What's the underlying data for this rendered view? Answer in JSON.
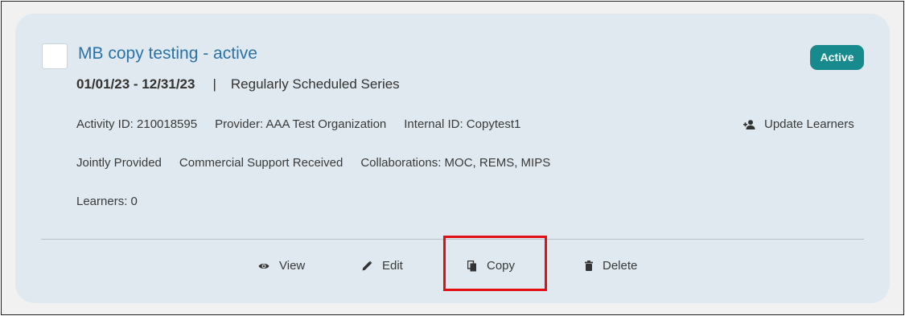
{
  "activity": {
    "title": "MB copy testing - active",
    "status": "Active",
    "dates": "01/01/23 - 12/31/23",
    "separator": "|",
    "series_type": "Regularly Scheduled Series",
    "activity_id": "Activity ID: 210018595",
    "provider": "Provider: AAA Test Organization",
    "internal_id": "Internal ID: Copytest1",
    "jointly_provided": "Jointly Provided",
    "commercial_support": "Commercial Support Received",
    "collaborations": "Collaborations: MOC, REMS, MIPS",
    "learners": "Learners: 0"
  },
  "actions": {
    "update_learners": "Update Learners",
    "view": "View",
    "edit": "Edit",
    "copy": "Copy",
    "delete": "Delete"
  },
  "icons": {
    "update_learners": "person-add-icon",
    "view": "eye-icon",
    "edit": "pencil-icon",
    "copy": "copy-icon",
    "delete": "trash-icon"
  },
  "colors": {
    "title": "#2a73a8",
    "status_badge": "#168a8c",
    "card_background": "#dfe9ef",
    "highlight": "#e20e14"
  }
}
